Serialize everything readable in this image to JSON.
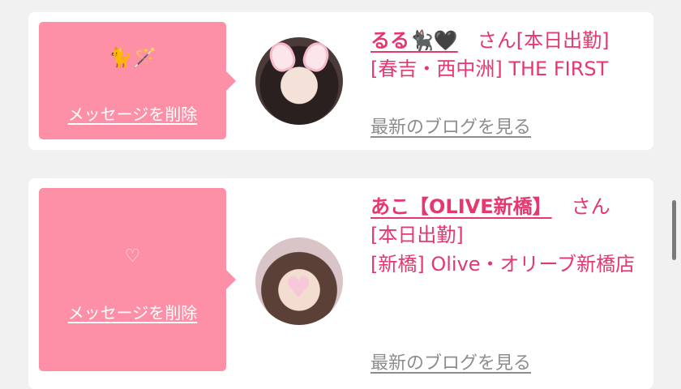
{
  "messages": [
    {
      "emoji": "🐈🪄",
      "delete_label": "メッセージを削除",
      "name": "るる🐈‍⬛🖤",
      "honorific": "さん",
      "line1": "[本日出勤]",
      "line2": "[春吉・西中洲] THE FIRST",
      "blog_label": "最新のブログを見る"
    },
    {
      "emoji": "♡",
      "delete_label": "メッセージを削除",
      "name": "あこ【OLIVE新橋】",
      "honorific": "さん",
      "line1": "[本日出勤]",
      "line2": "[新橋] Olive・オリーブ新橋店",
      "blog_label": "最新のブログを見る"
    }
  ]
}
